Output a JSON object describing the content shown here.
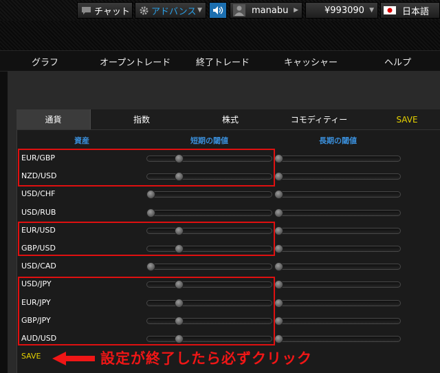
{
  "topbar": {
    "chat": "チャット",
    "mode": "アドバンス",
    "user": "manabu",
    "balance": "¥993090",
    "language": "日本語"
  },
  "nav": [
    "グラフ",
    "オープントレード",
    "終了トレード",
    "キャッシャー",
    "ヘルプ"
  ],
  "tabs": [
    "通貨",
    "指数",
    "株式",
    "コモディティー"
  ],
  "tab_save": "SAVE",
  "headers": {
    "asset": "資産",
    "short": "短期の閾値",
    "long": "長期の閾値"
  },
  "rows": [
    {
      "pair": "EUR/GBP",
      "short_level": 0.24,
      "long_level": 0.0
    },
    {
      "pair": "NZD/USD",
      "short_level": 0.24,
      "long_level": 0.0
    },
    {
      "pair": "USD/CHF",
      "short_level": 0.0,
      "long_level": 0.0
    },
    {
      "pair": "USD/RUB",
      "short_level": 0.0,
      "long_level": 0.0
    },
    {
      "pair": "EUR/USD",
      "short_level": 0.24,
      "long_level": 0.0
    },
    {
      "pair": "GBP/USD",
      "short_level": 0.24,
      "long_level": 0.0
    },
    {
      "pair": "USD/CAD",
      "short_level": 0.0,
      "long_level": 0.0
    },
    {
      "pair": "USD/JPY",
      "short_level": 0.24,
      "long_level": 0.0
    },
    {
      "pair": "EUR/JPY",
      "short_level": 0.24,
      "long_level": 0.0
    },
    {
      "pair": "GBP/JPY",
      "short_level": 0.24,
      "long_level": 0.0
    },
    {
      "pair": "AUD/USD",
      "short_level": 0.24,
      "long_level": 0.0
    }
  ],
  "save_bottom": "SAVE",
  "annotation": "設定が終了したら必ずクリック",
  "colors": {
    "header_blue": "#3a8ed9",
    "save_yellow": "#e6d200",
    "annotation_red": "#e01010",
    "mode_blue": "#2aa0e8"
  },
  "icons": [
    "chat-icon",
    "gear-icon",
    "speaker-icon",
    "user-icon",
    "japan-flag-icon",
    "left-arrow-icon"
  ]
}
